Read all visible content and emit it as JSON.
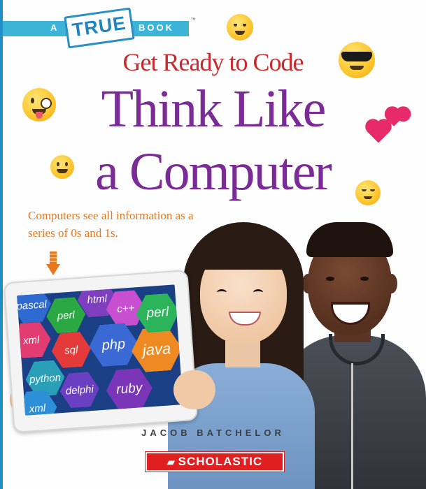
{
  "series": {
    "prefix": "A",
    "logo_word": "TRUE",
    "suffix": "BOOK",
    "trademark": "™"
  },
  "subtitle": "Get Ready to Code",
  "title": {
    "line1": "Think Like",
    "line2": "a Computer"
  },
  "caption": "Computers see all information as a series of 0s and 1s.",
  "tablet_words": [
    "pascal",
    "perl",
    "html",
    "c++",
    "xml",
    "sql",
    "php",
    "java",
    "python",
    "delphi",
    "ruby",
    "java",
    "perl",
    "xml"
  ],
  "author": "JACOB BATCHELOR",
  "publisher": {
    "name": "SCHOLASTIC",
    "icon": "book-icon"
  },
  "colors": {
    "title_purple": "#7a2b96",
    "subtitle_red": "#c92a2e",
    "caption_orange": "#e8781e",
    "banner_blue": "#3cb4d8",
    "publisher_red": "#e02020"
  }
}
